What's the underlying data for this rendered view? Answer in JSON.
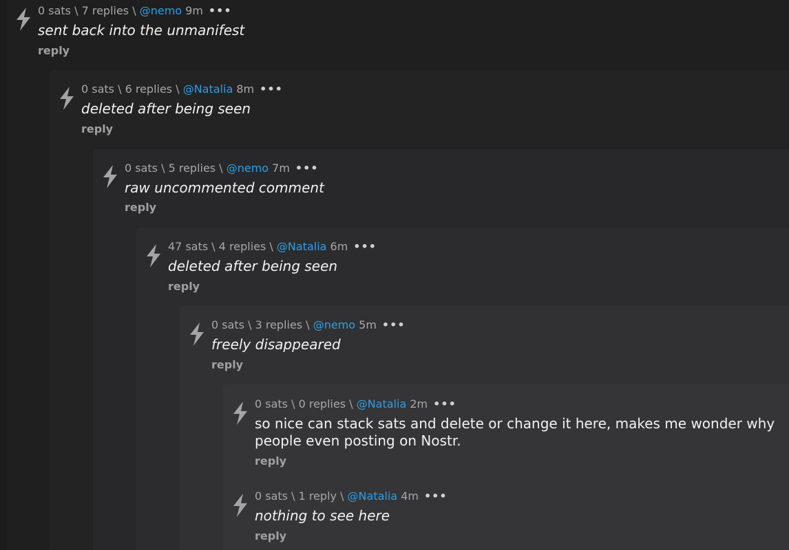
{
  "comments": [
    {
      "sats": "0 sats",
      "sep1": " \\ ",
      "replies": "7 replies",
      "sep2": " \\ ",
      "user": "@nemo",
      "time": "9m",
      "more": "•••",
      "text": "sent back into the unmanifest",
      "reply": "reply"
    },
    {
      "sats": "0 sats",
      "sep1": " \\ ",
      "replies": "6 replies",
      "sep2": " \\ ",
      "user": "@Natalia",
      "time": "8m",
      "more": "•••",
      "text": "deleted after being seen",
      "reply": "reply"
    },
    {
      "sats": "0 sats",
      "sep1": " \\ ",
      "replies": "5 replies",
      "sep2": " \\ ",
      "user": "@nemo",
      "time": "7m",
      "more": "•••",
      "text": "raw uncommented comment",
      "reply": "reply"
    },
    {
      "sats": "47 sats",
      "sep1": " \\ ",
      "replies": "4 replies",
      "sep2": " \\ ",
      "user": "@Natalia",
      "time": "6m",
      "more": "•••",
      "text": "deleted after being seen",
      "reply": "reply"
    },
    {
      "sats": "0 sats",
      "sep1": " \\ ",
      "replies": "3 replies",
      "sep2": " \\ ",
      "user": "@nemo",
      "time": "5m",
      "more": "•••",
      "text": "freely disappeared",
      "reply": "reply"
    },
    {
      "sats": "0 sats",
      "sep1": " \\ ",
      "replies": "0 replies",
      "sep2": " \\ ",
      "user": "@Natalia",
      "time": "2m",
      "more": "•••",
      "text": "so nice can stack sats and delete or change it here, makes me wonder why people even posting on Nostr.",
      "reply": "reply"
    },
    {
      "sats": "0 sats",
      "sep1": " \\ ",
      "replies": "1 reply",
      "sep2": " \\ ",
      "user": "@Natalia",
      "time": "4m",
      "more": "•••",
      "text": "nothing to see here",
      "reply": "reply"
    }
  ]
}
